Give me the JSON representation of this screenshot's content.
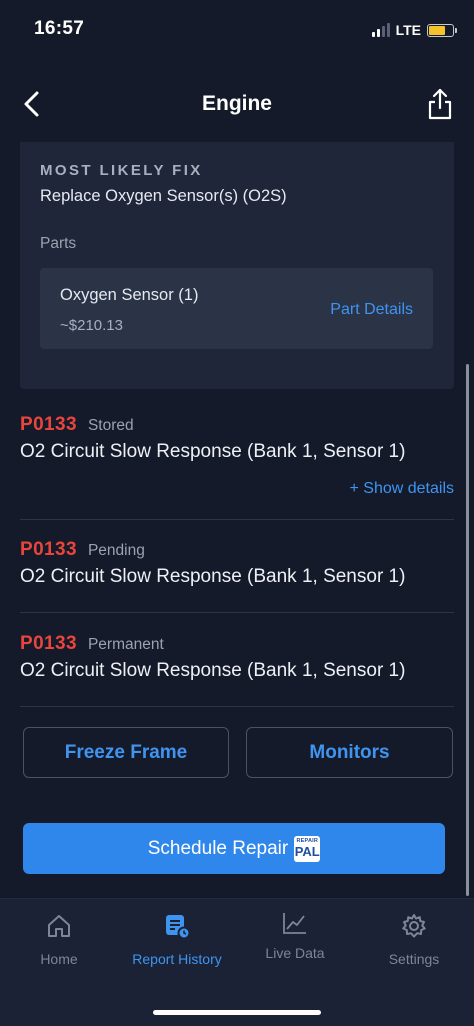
{
  "status_bar": {
    "time": "16:57",
    "network": "LTE"
  },
  "nav": {
    "title": "Engine"
  },
  "fix_card": {
    "heading": "MOST LIKELY FIX",
    "fix": "Replace Oxygen Sensor(s) (O2S)",
    "parts_label": "Parts",
    "part": {
      "name": "Oxygen Sensor (1)",
      "price": "~$210.13",
      "details_label": "Part Details"
    }
  },
  "codes": [
    {
      "code": "P0133",
      "status": "Stored",
      "description": "O2 Circuit Slow Response (Bank 1, Sensor 1)",
      "show_details": "+ Show details"
    },
    {
      "code": "P0133",
      "status": "Pending",
      "description": "O2 Circuit Slow Response (Bank 1, Sensor 1)"
    },
    {
      "code": "P0133",
      "status": "Permanent",
      "description": "O2 Circuit Slow Response (Bank 1, Sensor 1)"
    }
  ],
  "buttons": {
    "freeze_frame": "Freeze Frame",
    "monitors": "Monitors",
    "schedule_repair": "Schedule Repair",
    "repair_pal_small": "REPAIR",
    "repair_pal_big": "PAL"
  },
  "tabs": [
    {
      "label": "Home",
      "icon": "home-icon"
    },
    {
      "label": "Report History",
      "icon": "report-history-icon",
      "active": true
    },
    {
      "label": "Live Data",
      "icon": "live-data-icon"
    },
    {
      "label": "Settings",
      "icon": "gear-icon"
    }
  ],
  "colors": {
    "background": "#141a2a",
    "card": "#1f2639",
    "accent": "#2f87ec",
    "code_red": "#e8453c"
  }
}
